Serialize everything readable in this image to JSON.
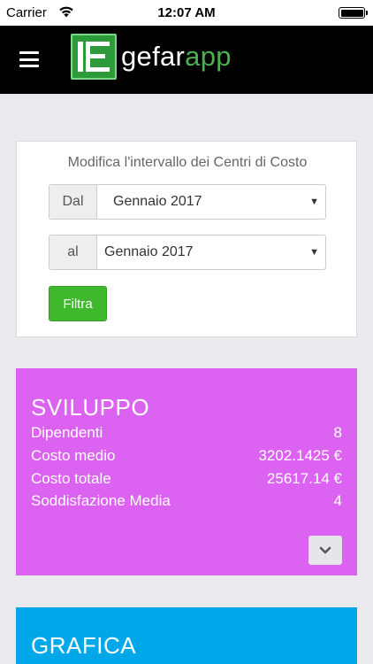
{
  "status_bar": {
    "carrier": "Carrier",
    "time": "12:07 AM"
  },
  "header": {
    "logo_text_part1": "gefar",
    "logo_text_part2": "app",
    "logo_color": "#2e9b3a"
  },
  "filter": {
    "title": "Modifica l'intervallo dei Centri di Costo",
    "from_label": "Dal",
    "from_value": "Gennaio 2017",
    "to_label": "al",
    "to_value": "Gennaio 2017",
    "button_label": "Filtra",
    "button_color": "#3fb82d"
  },
  "summary": {
    "title": "SVILUPPO",
    "color": "#dc62f1",
    "rows": [
      {
        "label": "Dipendenti",
        "value": "8"
      },
      {
        "label": "Costo medio",
        "value": "3202.1425 €"
      },
      {
        "label": "Costo totale",
        "value": "25617.14 €"
      },
      {
        "label": "Soddisfazione Media",
        "value": "4"
      }
    ],
    "expand_icon": "chevron-down-icon"
  },
  "chart_section": {
    "title": "GRAFICA",
    "color": "#00a7e9"
  }
}
